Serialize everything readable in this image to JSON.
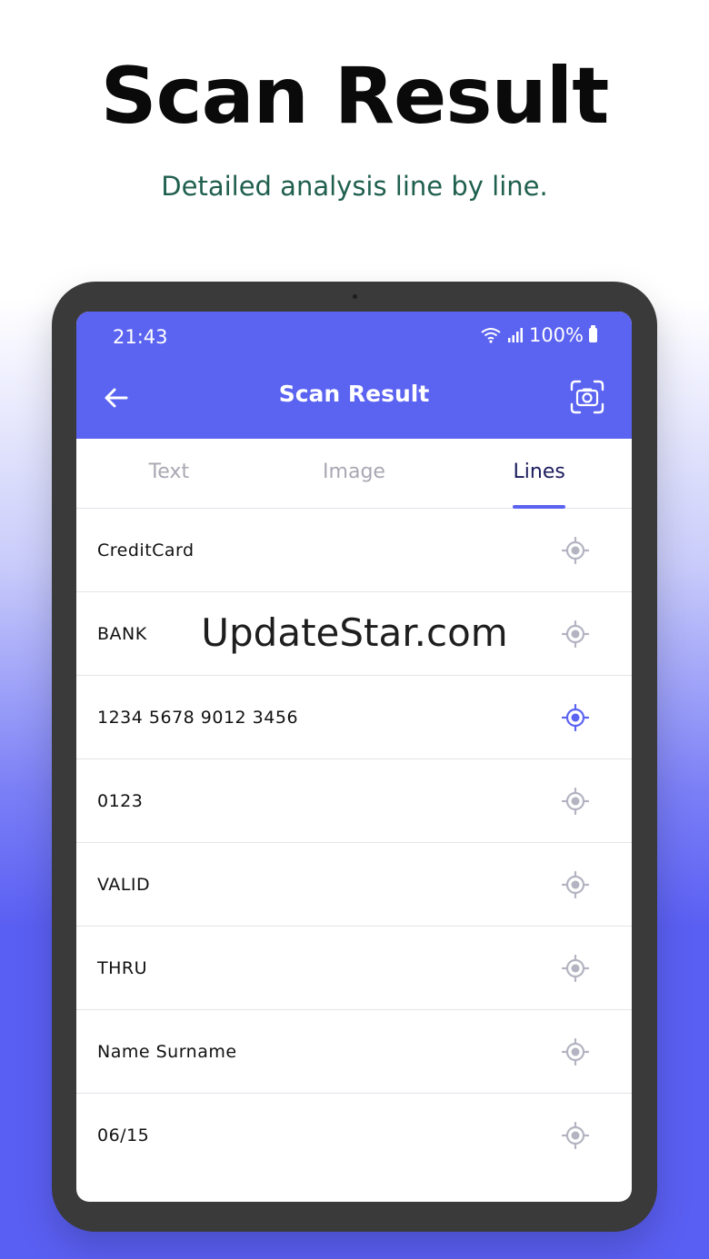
{
  "headline": "Scan Result",
  "subline": "Detailed analysis line by line.",
  "status_bar": {
    "time": "21:43",
    "battery": "100%"
  },
  "app_bar": {
    "title": "Scan Result"
  },
  "tabs": [
    {
      "label": "Text",
      "active": false
    },
    {
      "label": "Image",
      "active": false
    },
    {
      "label": "Lines",
      "active": true
    }
  ],
  "lines": [
    {
      "text": "CreditCard",
      "selected": false
    },
    {
      "text": "BANK",
      "selected": false
    },
    {
      "text": "1234 5678 9012 3456",
      "selected": true
    },
    {
      "text": "0123",
      "selected": false
    },
    {
      "text": "VALID",
      "selected": false
    },
    {
      "text": "THRU",
      "selected": false
    },
    {
      "text": "Name Surname",
      "selected": false
    },
    {
      "text": "06/15",
      "selected": false
    }
  ],
  "watermark": "UpdateStar.com",
  "icons": {
    "back": "arrow-left-icon",
    "scan": "camera-scan-icon",
    "locate": "crosshair-target-icon",
    "wifi": "wifi-icon",
    "signal": "signal-icon",
    "battery": "battery-icon"
  },
  "colors": {
    "accent": "#5b63f1",
    "locate_idle": "#b3b3c2",
    "locate_active": "#5b63f1",
    "tab_inactive": "#a8a8b3",
    "tab_active": "#1c1c5e",
    "subline": "#1f5f4e"
  }
}
